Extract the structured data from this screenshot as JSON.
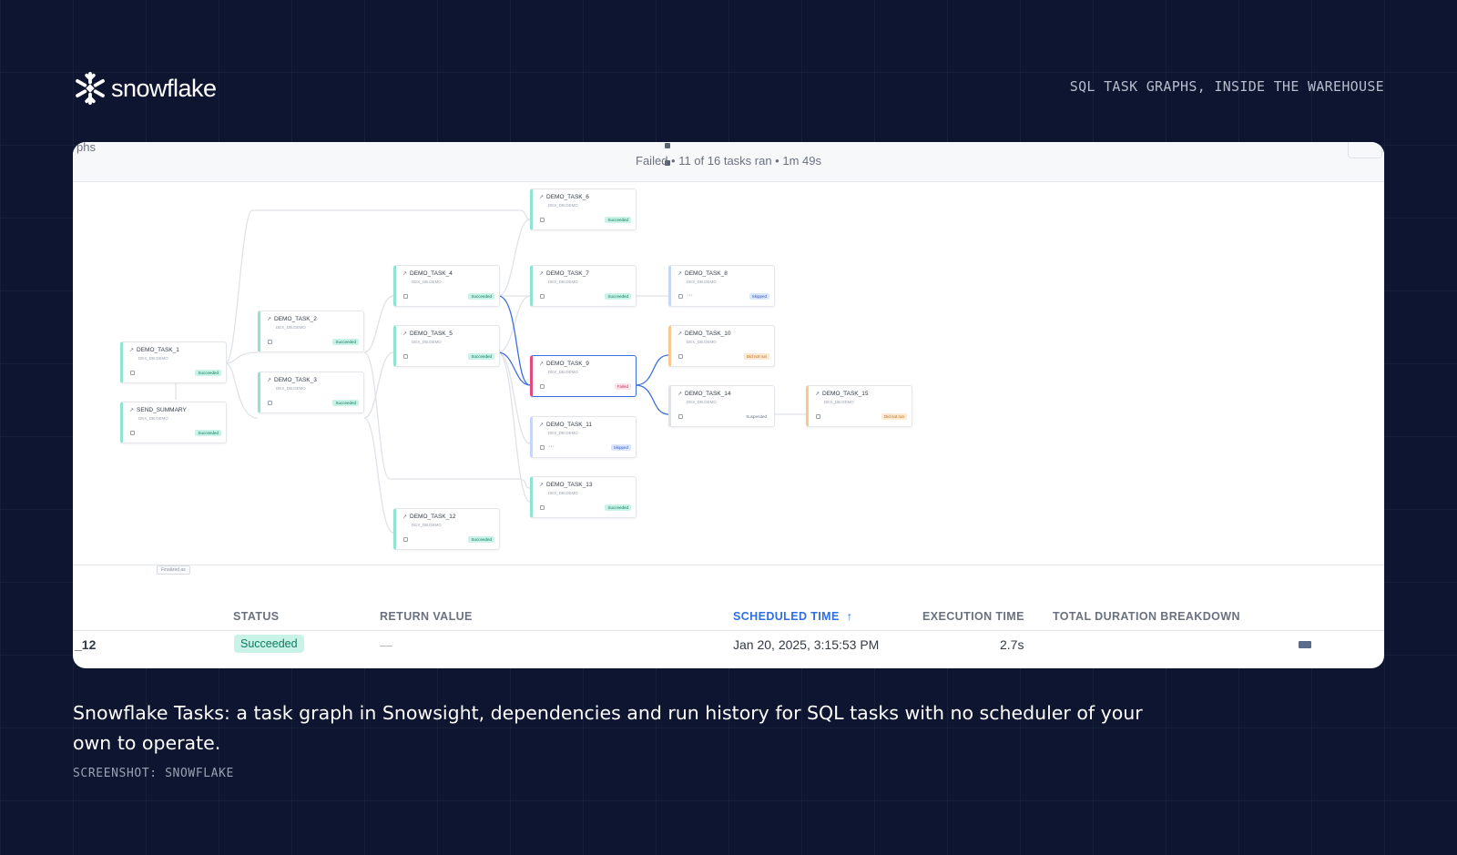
{
  "header": {
    "logo_text": "snowflake",
    "logo_icon": "snowflake-icon",
    "tagline": "SQL TASK GRAPHS, INSIDE THE WAREHOUSE"
  },
  "snowsight": {
    "breadcrumb_fragment": "phs",
    "run_summary": "Failed • 11 of 16 tasks ran • 1m 49s",
    "finalized_label": "Finalized as",
    "nodes": [
      {
        "name": "DEMO_TASK_1",
        "status": "Succeeded"
      },
      {
        "name": "SEND_SUMMARY",
        "status": "Succeeded"
      },
      {
        "name": "DEMO_TASK_2",
        "status": "Succeeded"
      },
      {
        "name": "DEMO_TASK_3",
        "status": "Succeeded"
      },
      {
        "name": "DEMO_TASK_4",
        "status": "Succeeded"
      },
      {
        "name": "DEMO_TASK_5",
        "status": "Succeeded"
      },
      {
        "name": "DEMO_TASK_12",
        "status": "Succeeded"
      },
      {
        "name": "DEMO_TASK_6",
        "status": "Succeeded"
      },
      {
        "name": "DEMO_TASK_7",
        "status": "Succeeded"
      },
      {
        "name": "DEMO_TASK_9",
        "status": "Failed"
      },
      {
        "name": "DEMO_TASK_11",
        "status": "Skipped"
      },
      {
        "name": "DEMO_TASK_13",
        "status": "Succeeded"
      },
      {
        "name": "DEMO_TASK_8",
        "status": "Skipped"
      },
      {
        "name": "DEMO_TASK_10",
        "status": "Did not run"
      },
      {
        "name": "DEMO_TASK_14",
        "status": "Suspended"
      },
      {
        "name": "DEMO_TASK_15",
        "status": "Did not run"
      }
    ],
    "table": {
      "headers": {
        "status": "STATUS",
        "return_value": "RETURN VALUE",
        "scheduled_time": "SCHEDULED TIME",
        "execution_time": "EXECUTION TIME",
        "total_duration": "TOTAL DURATION BREAKDOWN"
      },
      "sort_icon": "arrow-up-icon",
      "row": {
        "name_fragment": "_12",
        "status": "Succeeded",
        "return_value": "—",
        "scheduled_time": "Jan 20, 2025, 3:15:53 PM",
        "execution_time": "2.7s"
      }
    }
  },
  "caption": "Snowflake Tasks: a task graph in Snowsight, dependencies and run history for SQL tasks with no scheduler of your own to operate.",
  "credit": "SCREENSHOT: SNOWFLAKE",
  "colors": {
    "background": "#0d1530",
    "accent_blue": "#2f6fe4",
    "success_bg": "#c9f3e7",
    "failed_accent": "#e34a7c"
  }
}
